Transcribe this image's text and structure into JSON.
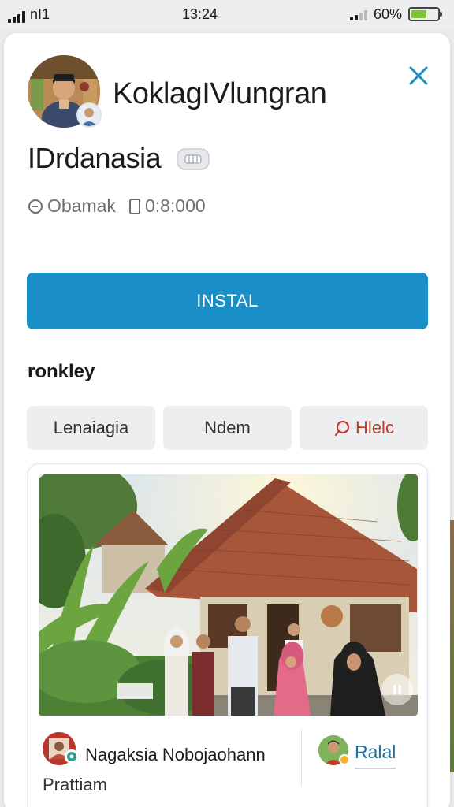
{
  "status_bar": {
    "carrier": "nI1",
    "time": "13:24",
    "battery": "60%",
    "battery_level": 0.6
  },
  "app": {
    "title": "KoklagIVlungran",
    "developer": "IDrdanasia",
    "meta": {
      "category": "Obamak",
      "count": "0:8:000"
    },
    "install_label": "INSTAL"
  },
  "section": {
    "title": "ronkley",
    "chips": [
      "Lenaiagia",
      "Ndem",
      "Hlelc"
    ]
  },
  "post": {
    "poster_name": "Nagaksia Nobojaohann",
    "poster_sub": "Prattiam",
    "side_name": "Ralal"
  },
  "colors": {
    "accent": "#1a8fc7",
    "close": "#1a8fc7",
    "chip_alert": "#c0392b",
    "battery": "#7cc432"
  },
  "icons": [
    "close-icon",
    "cloud-icon",
    "clock-icon",
    "phone-icon",
    "search-icon",
    "pause-icon",
    "verified-icon"
  ]
}
